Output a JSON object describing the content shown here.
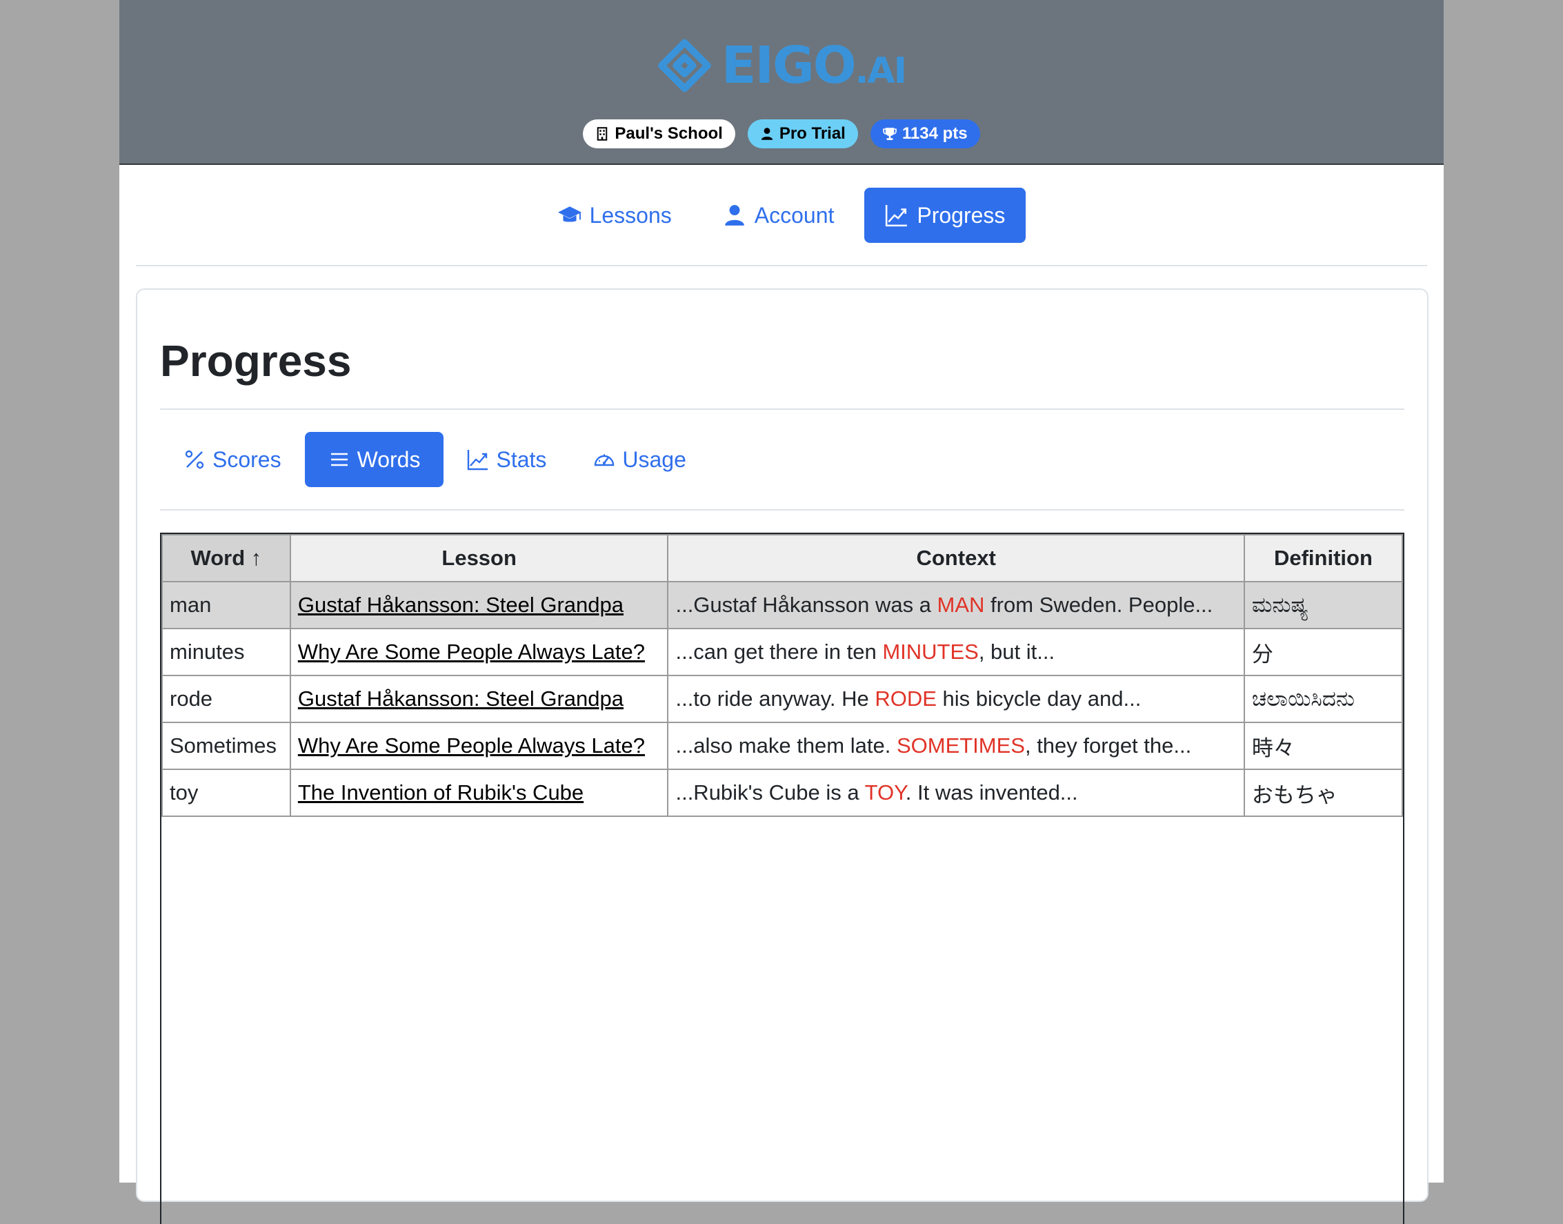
{
  "brand": {
    "name": "EIGO",
    "suffix": ".AI",
    "color": "#3a93d9"
  },
  "badges": {
    "school": "Paul's School",
    "plan": "Pro Trial",
    "points": "1134 pts"
  },
  "nav": {
    "items": [
      {
        "label": "Lessons",
        "icon": "graduation-cap-icon",
        "active": false
      },
      {
        "label": "Account",
        "icon": "person-icon",
        "active": false
      },
      {
        "label": "Progress",
        "icon": "graph-up-icon",
        "active": true
      }
    ]
  },
  "page": {
    "title": "Progress"
  },
  "tabs": [
    {
      "label": "Scores",
      "icon": "percent-icon",
      "active": false
    },
    {
      "label": "Words",
      "icon": "list-icon",
      "active": true
    },
    {
      "label": "Stats",
      "icon": "graph-up-icon",
      "active": false
    },
    {
      "label": "Usage",
      "icon": "speedometer-icon",
      "active": false
    }
  ],
  "table": {
    "headers": [
      "Word ↑",
      "Lesson",
      "Context",
      "Definition"
    ],
    "rows": [
      {
        "word": "man",
        "lesson": "Gustaf Håkansson: Steel Grandpa",
        "context_before": "...Gustaf Håkansson was a ",
        "context_word": "MAN",
        "context_after": " from Sweden. People...",
        "definition": "ಮನುಷ್ಯ"
      },
      {
        "word": "minutes",
        "lesson": "Why Are Some People Always Late?",
        "context_before": "...can get there in ten ",
        "context_word": "MINUTES",
        "context_after": ", but it...",
        "definition": "分"
      },
      {
        "word": "rode",
        "lesson": "Gustaf Håkansson: Steel Grandpa",
        "context_before": "...to ride anyway. He ",
        "context_word": "RODE",
        "context_after": " his bicycle day and...",
        "definition": "ಚಲಾಯಿಸಿದನು"
      },
      {
        "word": "Sometimes",
        "lesson": "Why Are Some People Always Late?",
        "context_before": "...also make them late. ",
        "context_word": "SOMETIMES",
        "context_after": ", they forget the...",
        "definition": "時々"
      },
      {
        "word": "toy",
        "lesson": "The Invention of Rubik's Cube",
        "context_before": "...Rubik's Cube is a ",
        "context_word": "TOY",
        "context_after": ". It was invented...",
        "definition": "おもちゃ"
      }
    ]
  }
}
